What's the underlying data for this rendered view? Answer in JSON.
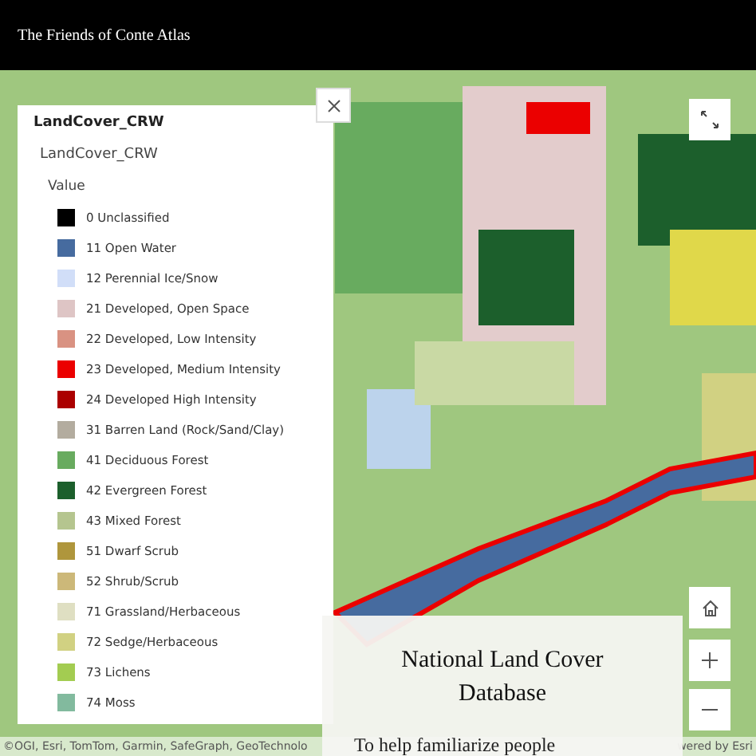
{
  "header": {
    "title": "The Friends of Conte Atlas"
  },
  "legend": {
    "title": "LandCover_CRW",
    "layer": "LandCover_CRW",
    "field": "Value",
    "items": [
      {
        "label": "0 Unclassified",
        "color": "#000000"
      },
      {
        "label": "11 Open Water",
        "color": "#466b9f"
      },
      {
        "label": "12 Perennial Ice/Snow",
        "color": "#d1def8"
      },
      {
        "label": "21 Developed, Open Space",
        "color": "#dec5c5"
      },
      {
        "label": "22 Developed, Low Intensity",
        "color": "#d99282"
      },
      {
        "label": "23 Developed, Medium Intensity",
        "color": "#eb0000"
      },
      {
        "label": "24 Developed High Intensity",
        "color": "#ab0000"
      },
      {
        "label": "31 Barren Land (Rock/Sand/Clay)",
        "color": "#b3ac9f"
      },
      {
        "label": "41 Deciduous Forest",
        "color": "#68ab5f"
      },
      {
        "label": "42 Evergreen Forest",
        "color": "#1c5f2c"
      },
      {
        "label": "43 Mixed Forest",
        "color": "#b5c58f"
      },
      {
        "label": "51 Dwarf Scrub",
        "color": "#af963c"
      },
      {
        "label": "52 Shrub/Scrub",
        "color": "#ccb879"
      },
      {
        "label": "71 Grassland/Herbaceous",
        "color": "#dfdfc2"
      },
      {
        "label": "72 Sedge/Herbaceous",
        "color": "#d1d182"
      },
      {
        "label": "73 Lichens",
        "color": "#a3cc51"
      },
      {
        "label": "74 Moss",
        "color": "#82ba9e"
      }
    ]
  },
  "attribution": {
    "sources": "©OGI, Esri, TomTom, Garmin, SafeGraph, GeoTechnolo",
    "powered": "wered by Esri"
  },
  "info_card": {
    "title": "National Land Cover Database",
    "text": "To help familiarize people"
  }
}
